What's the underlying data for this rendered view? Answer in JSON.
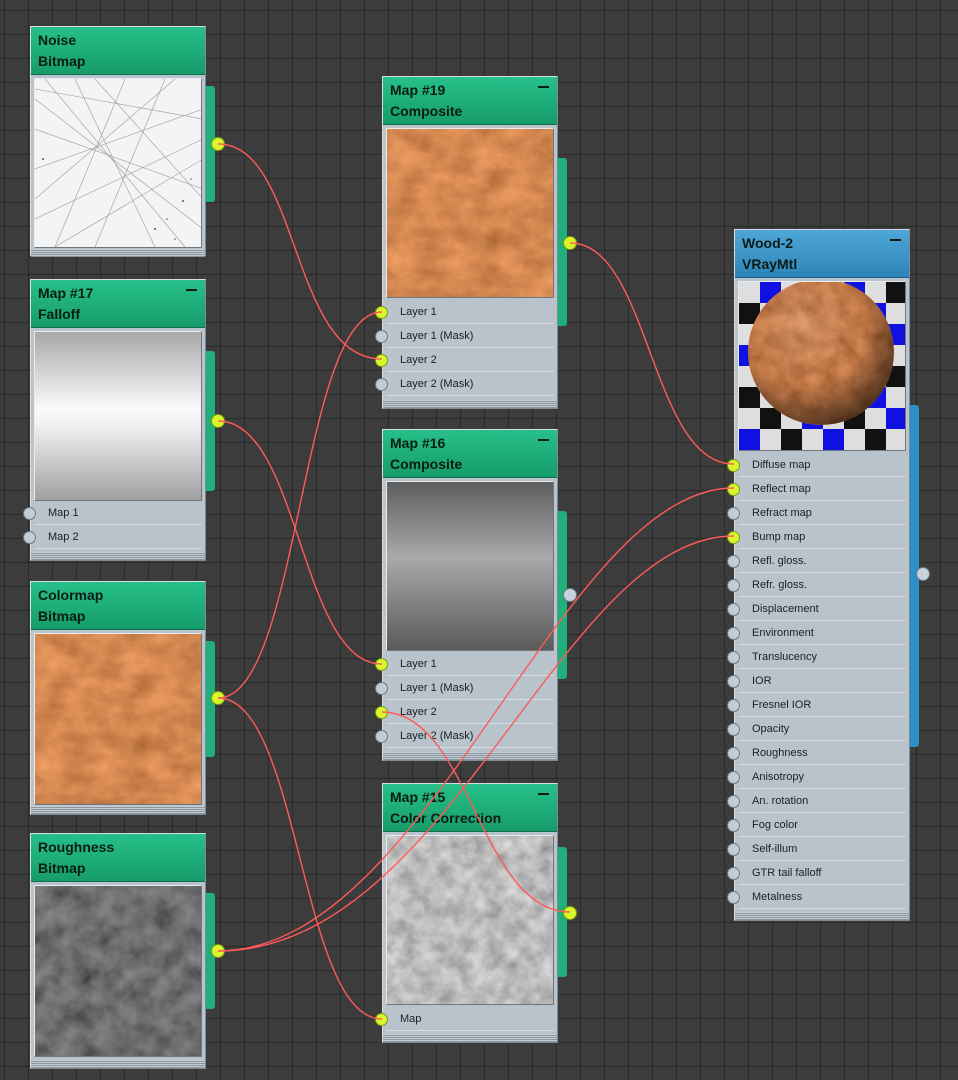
{
  "wire_color": "#ff5a5a",
  "socket_connected_color": "#d9f52c",
  "node_header_color": "#1faf78",
  "material_header_color": "#3c96cb",
  "nodes": {
    "noise": {
      "name": "Noise",
      "type": "Bitmap"
    },
    "map17": {
      "name": "Map #17",
      "type": "Falloff",
      "slots": [
        "Map 1",
        "Map 2"
      ]
    },
    "colormap": {
      "name": "Colormap",
      "type": "Bitmap"
    },
    "roughness": {
      "name": "Roughness",
      "type": "Bitmap"
    },
    "map19": {
      "name": "Map #19",
      "type": "Composite",
      "slots": [
        "Layer 1",
        "Layer 1 (Mask)",
        "Layer 2",
        "Layer 2 (Mask)"
      ]
    },
    "map16": {
      "name": "Map #16",
      "type": "Composite",
      "slots": [
        "Layer 1",
        "Layer 1 (Mask)",
        "Layer 2",
        "Layer 2 (Mask)"
      ]
    },
    "map15": {
      "name": "Map #15",
      "type": "Color Correction",
      "slots": [
        "Map"
      ]
    },
    "wood2": {
      "name": "Wood-2",
      "type": "VRayMtl",
      "slots": [
        "Diffuse map",
        "Reflect map",
        "Refract map",
        "Bump map",
        "Refl. gloss.",
        "Refr. gloss.",
        "Displacement",
        "Environment",
        "Translucency",
        "IOR",
        "Fresnel IOR",
        "Opacity",
        "Roughness",
        "Anisotropy",
        "An. rotation",
        "Fog color",
        "Self-illum",
        "GTR tail falloff",
        "Metalness"
      ]
    }
  }
}
